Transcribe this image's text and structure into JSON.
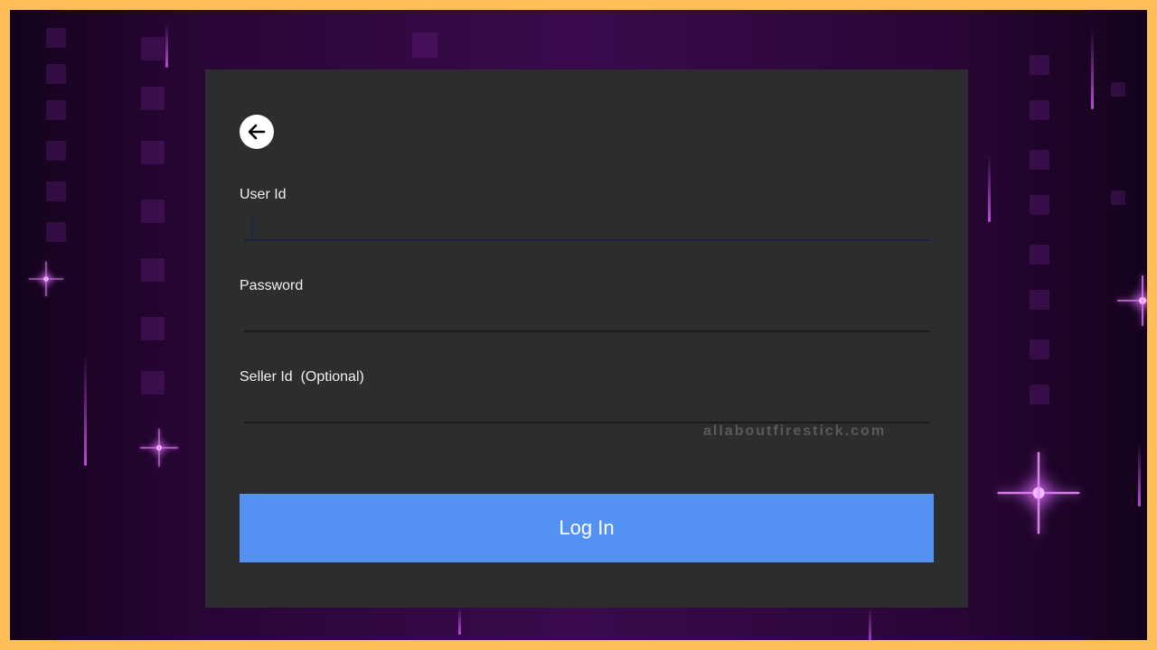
{
  "dialog": {
    "back_icon": "arrow-left-icon",
    "fields": [
      {
        "label": "User Id",
        "value": "",
        "placeholder": ""
      },
      {
        "label": "Password",
        "value": "",
        "placeholder": ""
      },
      {
        "label": "Seller Id  (Optional)",
        "value": "",
        "placeholder": ""
      }
    ],
    "login_label": "Log In",
    "watermark": "allaboutfirestick.com"
  },
  "colors": {
    "frame_border": "#ffbe57",
    "dialog_background": "#2c2d2d",
    "button_background": "#5391f2",
    "background_purple": "#3a0a4d"
  }
}
